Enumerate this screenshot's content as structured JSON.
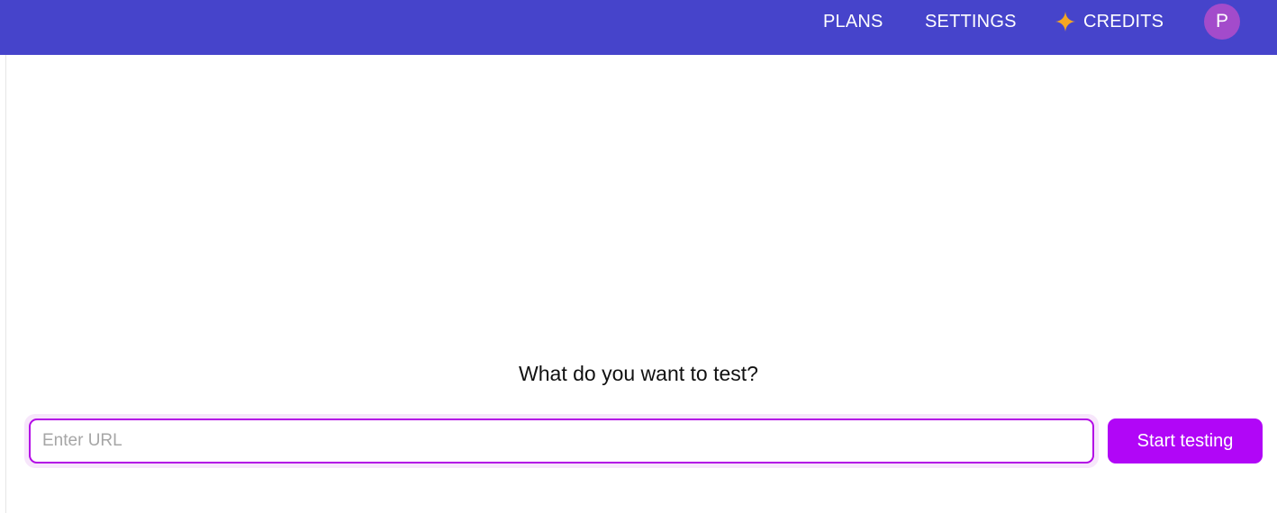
{
  "header": {
    "nav": {
      "plans": "PLANS",
      "settings": "SETTINGS",
      "credits": "CREDITS"
    },
    "credits_icon": "sparkle-icon",
    "avatar_initial": "P",
    "background_color": "#4644cb",
    "avatar_color": "#a34bcb",
    "sparkle_color": "#f5a623"
  },
  "main": {
    "prompt": "What do you want to test?",
    "url_input": {
      "placeholder": "Enter URL",
      "value": ""
    },
    "start_button_label": "Start testing",
    "accent_color": "#b106f7"
  }
}
